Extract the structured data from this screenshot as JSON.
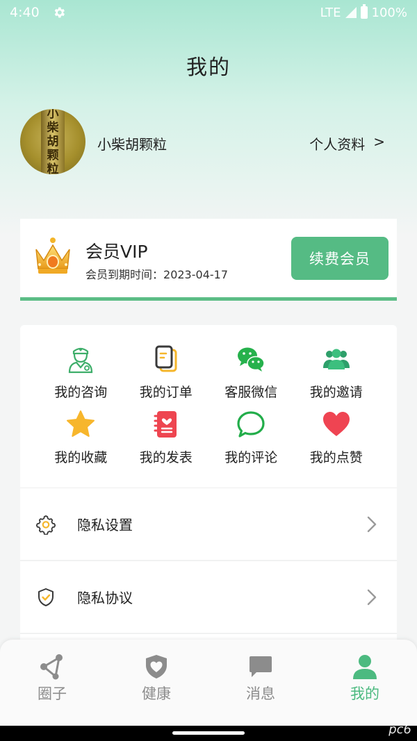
{
  "status_bar": {
    "time": "4:40",
    "network": "LTE",
    "battery": "100%"
  },
  "page": {
    "title": "我的"
  },
  "profile": {
    "username": "小柴胡颗粒",
    "avatar_text": [
      "小",
      "柴",
      "胡",
      "颗",
      "粒"
    ],
    "profile_link": "个人资料",
    "profile_arrow": ">"
  },
  "vip": {
    "title": "会员VIP",
    "expire_label": "会员到期时间：",
    "expire_date": "2023-04-17",
    "renew_button": "续费会员"
  },
  "features": [
    {
      "label": "我的咨询",
      "icon": "doctor-icon"
    },
    {
      "label": "我的订单",
      "icon": "order-icon"
    },
    {
      "label": "客服微信",
      "icon": "wechat-icon"
    },
    {
      "label": "我的邀请",
      "icon": "group-icon"
    },
    {
      "label": "我的收藏",
      "icon": "star-icon"
    },
    {
      "label": "我的发表",
      "icon": "notebook-icon"
    },
    {
      "label": "我的评论",
      "icon": "comment-icon"
    },
    {
      "label": "我的点赞",
      "icon": "heart-icon"
    }
  ],
  "menu": [
    {
      "label": "隐私设置",
      "icon": "gear-icon"
    },
    {
      "label": "隐私协议",
      "icon": "shield-check-icon"
    }
  ],
  "bottom_nav": [
    {
      "label": "圈子",
      "icon": "share-nodes-icon",
      "active": false
    },
    {
      "label": "健康",
      "icon": "shield-heart-icon",
      "active": false
    },
    {
      "label": "消息",
      "icon": "chat-icon",
      "active": false
    },
    {
      "label": "我的",
      "icon": "user-icon",
      "active": true
    }
  ],
  "colors": {
    "accent": "#55bb84",
    "active_tab": "#4cba80",
    "inactive_tab": "#8c8c8c"
  },
  "watermark": "pc6"
}
